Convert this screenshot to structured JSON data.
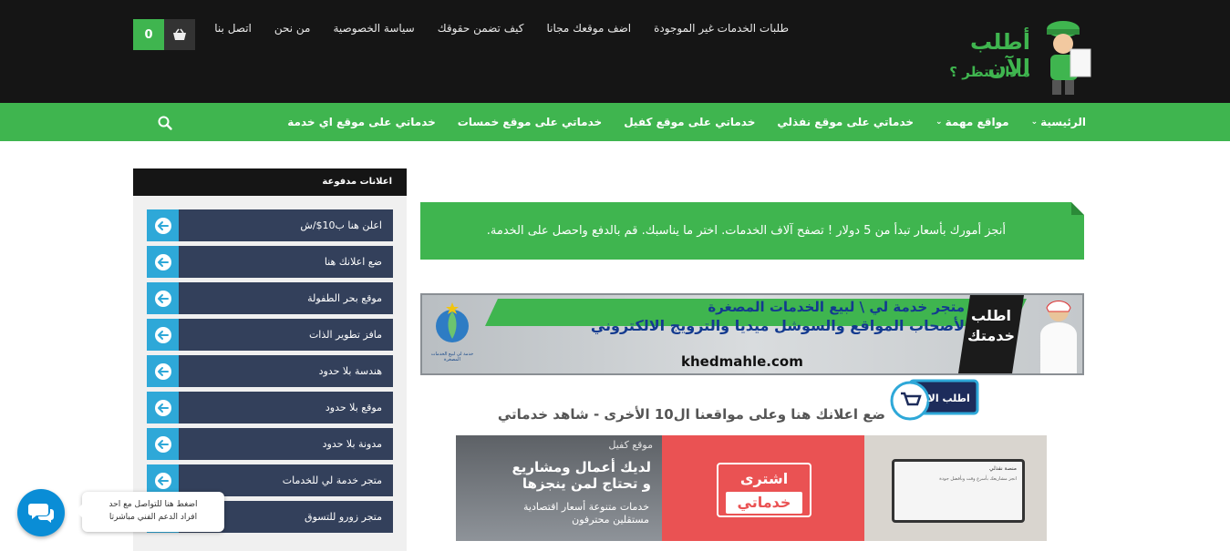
{
  "header": {
    "logo_line1": "أطلب الآن",
    "logo_line2": "ماذا تنتظر ؟",
    "top_links": [
      "طلبات الخدمات غير الموجودة",
      "اضف موقعك مجانا",
      "كيف تضمن حقوقك",
      "سياسة الخصوصية",
      "من نحن",
      "اتصل بنا"
    ],
    "cart_count": "0"
  },
  "nav": {
    "items": [
      "الرئيسية",
      "مواقع مهمة",
      "خدماتي على موقع نفذلي",
      "خدماتي على موقع كفيل",
      "خدماتي على موقع خمسات",
      "خدماتي على موقع اي خدمة"
    ],
    "accent": "#3fb54f"
  },
  "sidebar": {
    "title": "اعلانات مدفوعة",
    "items": [
      "اعلن هنا ب10$/ش",
      "ضع اعلانك هنا",
      "موقع بحر الطفولة",
      "مافز تطوير الذات",
      "هندسة بلا حدود",
      "موقع بلا حدود",
      "مدونة بلا حدود",
      "متجر خدمة لي للخدمات",
      "متجر زورو للتسوق"
    ]
  },
  "main": {
    "promo_text": "أنجز أمورك بأسعار تبدأ من 5 دولار ! تصفح آلاف الخدمات. اختر ما يناسبك. قم بالدفع واحصل على الخدمة.",
    "banner": {
      "line1": "متجر خدمة لي \\ لبيع الخدمات المصغرة",
      "line2": "لأصحاب المواقع والسوشل ميديا والترويج الالكتروني",
      "url": "khedmahle.com",
      "cta_line1": "اطلب",
      "cta_line2": "خدمتك",
      "logo_caption": "خدمة لي لبيع الخدمات المصغرة"
    },
    "badge_label": "اطلب الان",
    "ad_line": "ضع اعلانك هنا وعلى مواقعنا ال10 الأخرى - شاهد خدماتي",
    "tiles": {
      "kafeel_head": "موقع كفيل",
      "kafeel_main1": "لديك أعمال ومشاريع",
      "kafeel_main2": "و تحتاج لمن ينجزها",
      "kafeel_sub1": "خدمات متنوعة    أسعار اقتصادية",
      "kafeel_sub2": "مستقلين محترفون",
      "buy_line1": "اشترى",
      "buy_line2": "خدماتي",
      "nafethli_head": "منصة نفذلي",
      "nafethli_sub": "انجز مشاريعك بأسرع وقت وبأفضل جودة"
    }
  },
  "chat": {
    "line1": "اضغط هنا للتواصل مع احد",
    "line2": "افراد الدعم الفني مباشرتا"
  }
}
